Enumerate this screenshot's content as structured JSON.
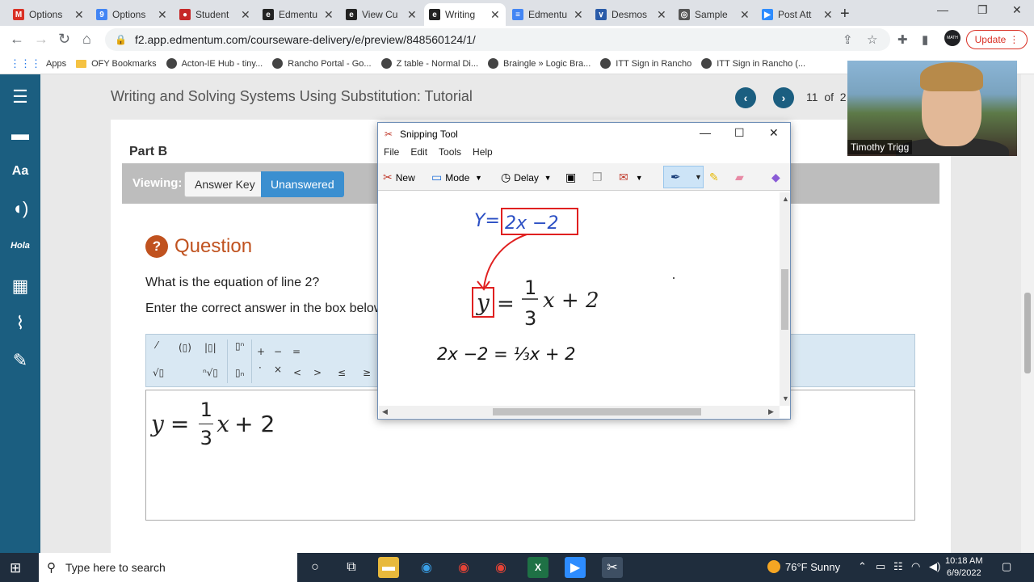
{
  "browser": {
    "tabs": [
      {
        "title": "Options",
        "icon": "gmail-icon",
        "color": "#d93025",
        "glyph": "M"
      },
      {
        "title": "Options",
        "icon": "google-forms-icon",
        "color": "#4285f4",
        "glyph": "9"
      },
      {
        "title": "Student",
        "icon": "apple-icon",
        "color": "#c62828",
        "glyph": "●"
      },
      {
        "title": "Edmentu",
        "icon": "edmentum-icon",
        "color": "#222222",
        "glyph": "e"
      },
      {
        "title": "View Cu",
        "icon": "edmentum-icon",
        "color": "#222222",
        "glyph": "e"
      },
      {
        "title": "Writing",
        "icon": "edmentum-icon",
        "color": "#222222",
        "glyph": "e",
        "active": true
      },
      {
        "title": "Edmentu",
        "icon": "google-docs-icon",
        "color": "#4285f4",
        "glyph": "≡"
      },
      {
        "title": "Desmos",
        "icon": "desmos-icon",
        "color": "#2a5ba8",
        "glyph": "∨"
      },
      {
        "title": "Sample",
        "icon": "globe-icon",
        "color": "#555555",
        "glyph": "◎"
      },
      {
        "title": "Post Att",
        "icon": "zoom-icon",
        "color": "#2d8cff",
        "glyph": "▶"
      }
    ],
    "url": "f2.app.edmentum.com/courseware-delivery/e/preview/848560124/1/",
    "update_label": "Update",
    "bookmarks": [
      {
        "label": "Apps",
        "kind": "grid"
      },
      {
        "label": "OFY Bookmarks",
        "kind": "folder"
      },
      {
        "label": "Acton-IE Hub - tiny...",
        "kind": "site"
      },
      {
        "label": "Rancho Portal - Go...",
        "kind": "site"
      },
      {
        "label": "Z table - Normal Di...",
        "kind": "site"
      },
      {
        "label": "Braingle » Logic Bra...",
        "kind": "site"
      },
      {
        "label": "ITT Sign in Rancho",
        "kind": "site"
      },
      {
        "label": "ITT Sign in Rancho (...",
        "kind": "site"
      }
    ]
  },
  "lesson": {
    "title": "Writing and Solving Systems Using Substitution: Tutorial",
    "page_current": "11",
    "page_of": "of",
    "page_total": "2"
  },
  "part": {
    "label": "Part B",
    "viewing_label": "Viewing:",
    "answer_key_label": "Answer Key",
    "unanswered_label": "Unanswered"
  },
  "question": {
    "heading": "Question",
    "line1": "What is the equation of line 2?",
    "line2": "Enter the correct answer in the box below."
  },
  "answer": {
    "lhs": "y",
    "eq": "=",
    "num": "1",
    "den": "3",
    "var": "x",
    "rest": "+ 2"
  },
  "snipping_tool": {
    "title": "Snipping Tool",
    "menu": [
      "File",
      "Edit",
      "Tools",
      "Help"
    ],
    "new_label": "New",
    "mode_label": "Mode",
    "delay_label": "Delay",
    "canvas": {
      "ink_top": "Y=",
      "ink_top_box": "2x −2",
      "typed_lhs": "y",
      "typed_rest": "x + 2",
      "ink_bottom": "2x −2 = ⅓x + 2"
    }
  },
  "webcam": {
    "name": "Timothy Trigg"
  },
  "taskbar": {
    "search_placeholder": "Type here to search",
    "weather": "76°F  Sunny",
    "time": "10:18 AM",
    "date": "6/9/2022"
  },
  "colors": {
    "edmentum_blue": "#1b5e80",
    "question_orange": "#c0521f",
    "unanswered_blue": "#3b8fd0",
    "ink_blue": "#2b4fc4",
    "ink_red": "#e02020"
  }
}
